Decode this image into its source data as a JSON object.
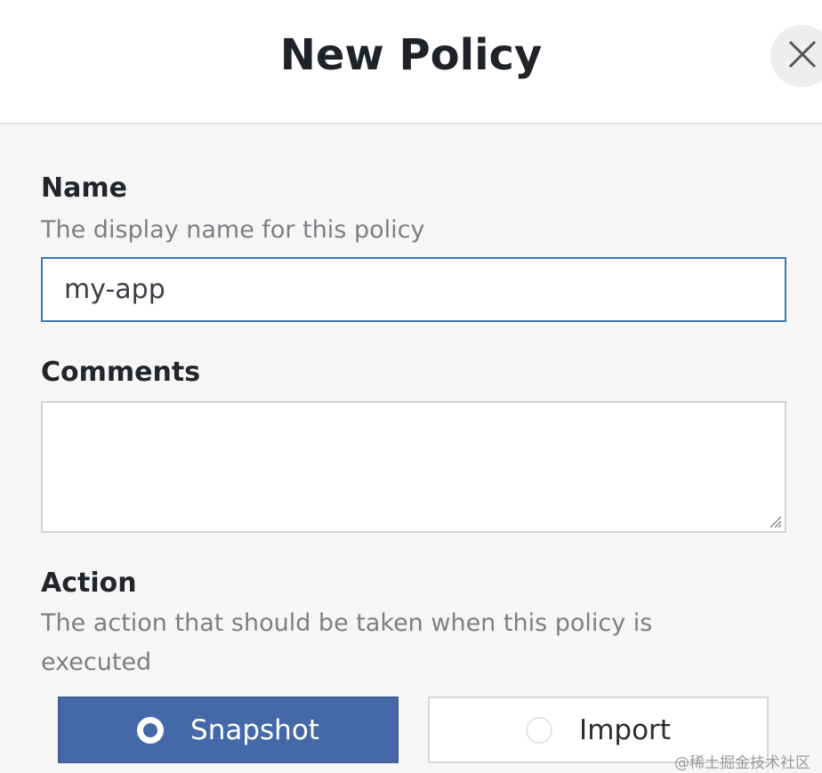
{
  "dialog": {
    "title": "New Policy",
    "close_icon": "close-icon"
  },
  "name_field": {
    "label": "Name",
    "help": "The display name for this policy",
    "value": "my-app"
  },
  "comments_field": {
    "label": "Comments",
    "value": ""
  },
  "action_field": {
    "label": "Action",
    "help": "The action that should be taken when this policy is executed",
    "options": [
      {
        "label": "Snapshot",
        "selected": true
      },
      {
        "label": "Import",
        "selected": false
      }
    ]
  },
  "colors": {
    "accent": "#4569a8",
    "input_focus_border": "#3d78b1"
  },
  "watermark": "@稀土掘金技术社区"
}
